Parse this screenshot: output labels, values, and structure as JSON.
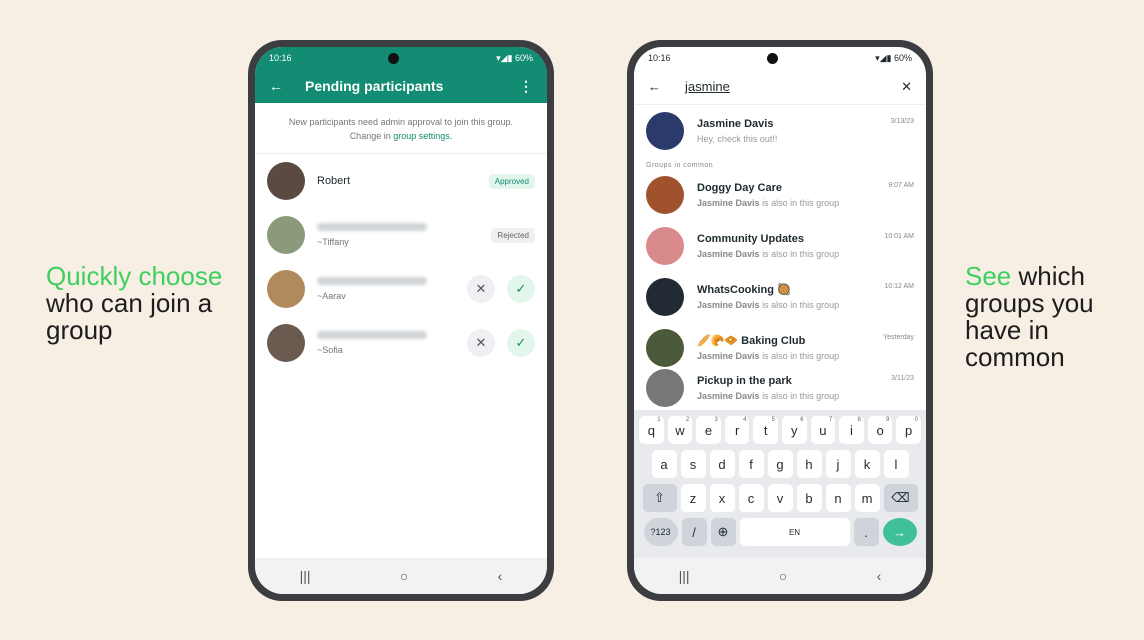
{
  "left_caption": {
    "highlight": "Quickly choose",
    "rest": "who can join a group"
  },
  "right_caption": {
    "highlight": "See",
    "rest": "which groups you have in common"
  },
  "status": {
    "time": "10:16",
    "battery": "60%"
  },
  "pending": {
    "title": "Pending participants",
    "note": "New participants need admin approval to join this group. Change in",
    "note_link": "group settings.",
    "rows": [
      {
        "name": "Robert",
        "status": "Approved",
        "avatar": "#5a4a42"
      },
      {
        "name": "~Tiffany",
        "status": "Rejected",
        "avatar": "#8a9a7a"
      },
      {
        "name": "~Aarav",
        "status": "",
        "avatar": "#b08a5a"
      },
      {
        "name": "~Sofia",
        "status": "",
        "avatar": "#6a5a50"
      }
    ]
  },
  "search": {
    "query": "jasmine",
    "contact": {
      "name": "Jasmine Davis",
      "msg": "Hey, check this out!!",
      "time": "3/13/23"
    },
    "section": "Groups in common",
    "groups": [
      {
        "name": "Doggy Day Care",
        "time": "9:07 AM",
        "avatar": "#a0522d"
      },
      {
        "name": "Community Updates",
        "time": "10:01 AM",
        "avatar": "#d98a8a"
      },
      {
        "name": "WhatsCooking 🥘",
        "time": "10:12 AM",
        "avatar": "#222a33"
      },
      {
        "name": "🥖🥐🧇 Baking Club",
        "time": "Yesterday",
        "avatar": "#4a5a3a"
      },
      {
        "name": "Pickup in the park",
        "time": "3/11/23",
        "avatar": "#777"
      }
    ],
    "member_name": "Jasmine Davis",
    "member_suffix": "is also in this group"
  },
  "keyboard": {
    "row1": [
      "q",
      "w",
      "e",
      "r",
      "t",
      "y",
      "u",
      "i",
      "o",
      "p"
    ],
    "nums": [
      "1",
      "2",
      "3",
      "4",
      "5",
      "6",
      "7",
      "8",
      "9",
      "0"
    ],
    "row2": [
      "a",
      "s",
      "d",
      "f",
      "g",
      "h",
      "j",
      "k",
      "l"
    ],
    "row3": [
      "z",
      "x",
      "c",
      "v",
      "b",
      "n",
      "m"
    ],
    "sym": "?123",
    "slash": "/",
    "space": "EN",
    "dot": "."
  },
  "colors": {
    "accent": "#128c72",
    "highlight": "#3fcf5f"
  }
}
